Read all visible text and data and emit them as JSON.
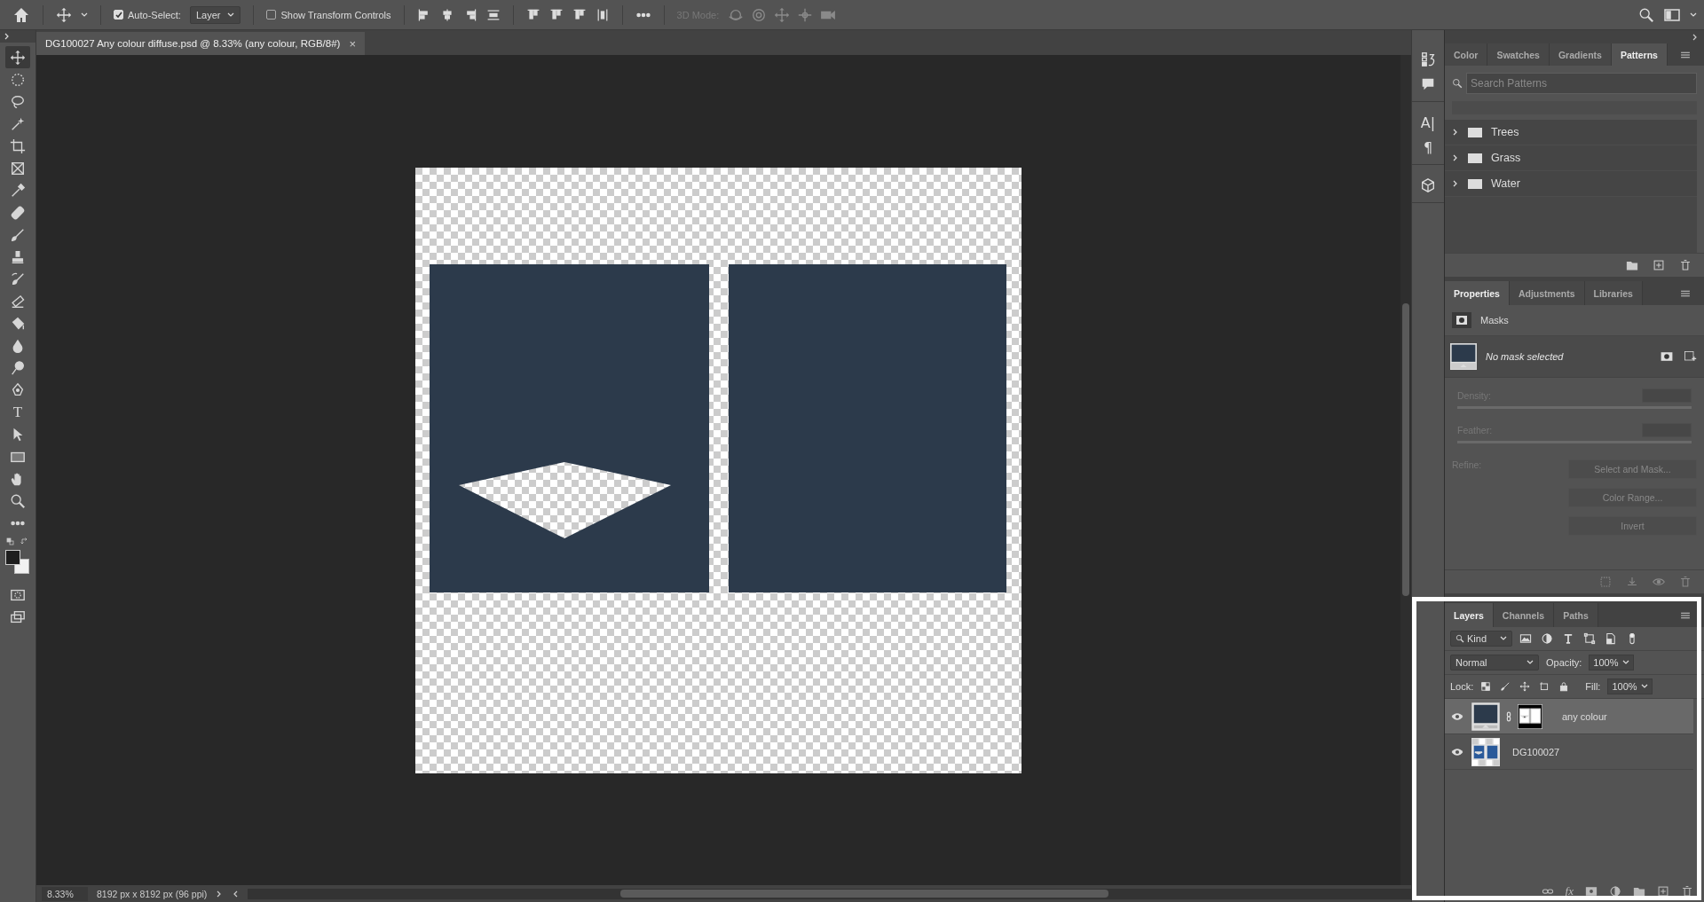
{
  "options_bar": {
    "auto_select": {
      "label": "Auto-Select:",
      "checked": true
    },
    "target": "Layer",
    "transform_controls": {
      "label": "Show Transform Controls",
      "checked": false
    },
    "mode_label": "3D Mode:"
  },
  "document_tab": {
    "title": "DG100027 Any colour diffuse.psd @ 8.33% (any colour, RGB/8#)",
    "close": "×"
  },
  "tools": [
    {
      "kind": "move",
      "selected": true
    },
    {
      "kind": "marquee",
      "selected": false
    },
    {
      "kind": "lasso",
      "selected": false
    },
    {
      "kind": "wand",
      "selected": false
    },
    {
      "kind": "crop",
      "selected": false
    },
    {
      "kind": "frame",
      "selected": false
    },
    {
      "kind": "eyedropper",
      "selected": false
    },
    {
      "kind": "healing",
      "selected": false
    },
    {
      "kind": "brush",
      "selected": false
    },
    {
      "kind": "stamp",
      "selected": false
    },
    {
      "kind": "history",
      "selected": false
    },
    {
      "kind": "eraser",
      "selected": false
    },
    {
      "kind": "bucket",
      "selected": false
    },
    {
      "kind": "blur",
      "selected": false
    },
    {
      "kind": "dodge",
      "selected": false
    },
    {
      "kind": "pen",
      "selected": false
    },
    {
      "kind": "type",
      "glyph": "T",
      "selected": false
    },
    {
      "kind": "select",
      "selected": false
    },
    {
      "kind": "rectangle",
      "selected": false
    },
    {
      "kind": "hand",
      "selected": false
    },
    {
      "kind": "zoom",
      "selected": false
    },
    {
      "kind": "more",
      "selected": false
    }
  ],
  "side_dock": [
    {
      "kind": "history"
    },
    {
      "kind": "comments"
    },
    {
      "kind": "character",
      "glyph": "A|"
    },
    {
      "kind": "paragraph",
      "glyph": "¶"
    },
    {
      "kind": "cube"
    }
  ],
  "patterns_panel": {
    "tabs": [
      {
        "label": "Color",
        "selected": false
      },
      {
        "label": "Swatches",
        "selected": false
      },
      {
        "label": "Gradients",
        "selected": false
      },
      {
        "label": "Patterns",
        "selected": true
      }
    ],
    "search": {
      "placeholder": "Search Patterns"
    },
    "groups": [
      {
        "name": "Trees",
        "expanded": false
      },
      {
        "name": "Grass",
        "expanded": false
      },
      {
        "name": "Water",
        "expanded": false
      }
    ]
  },
  "properties_panel": {
    "tabs": [
      {
        "label": "Properties",
        "selected": true
      },
      {
        "label": "Adjustments",
        "selected": false
      },
      {
        "label": "Libraries",
        "selected": false
      }
    ],
    "section": "Masks",
    "mask_status": "No mask selected",
    "density_label": "Density:",
    "feather_label": "Feather:",
    "refine_label": "Refine:",
    "buttons": [
      {
        "label": "Select and Mask...",
        "disabled": true
      },
      {
        "label": "Color Range...",
        "disabled": true
      },
      {
        "label": "Invert",
        "disabled": true
      }
    ]
  },
  "layers_panel": {
    "tabs": [
      {
        "label": "Layers",
        "selected": true
      },
      {
        "label": "Channels",
        "selected": false
      },
      {
        "label": "Paths",
        "selected": false
      }
    ],
    "filter": "Kind",
    "blend_mode": "Normal",
    "opacity_label": "Opacity:",
    "opacity": "100%",
    "lock_label": "Lock:",
    "fill_label": "Fill:",
    "fill": "100%",
    "effects": "fx",
    "layers": [
      {
        "name": "any colour",
        "visible": true,
        "selected": true,
        "has_mask": true
      },
      {
        "name": "DG100027",
        "visible": true,
        "selected": false,
        "has_mask": false
      }
    ]
  },
  "status_bar": {
    "zoom": "8.33%",
    "document_size": "8192 px x 8192 px (96 ppi)"
  }
}
